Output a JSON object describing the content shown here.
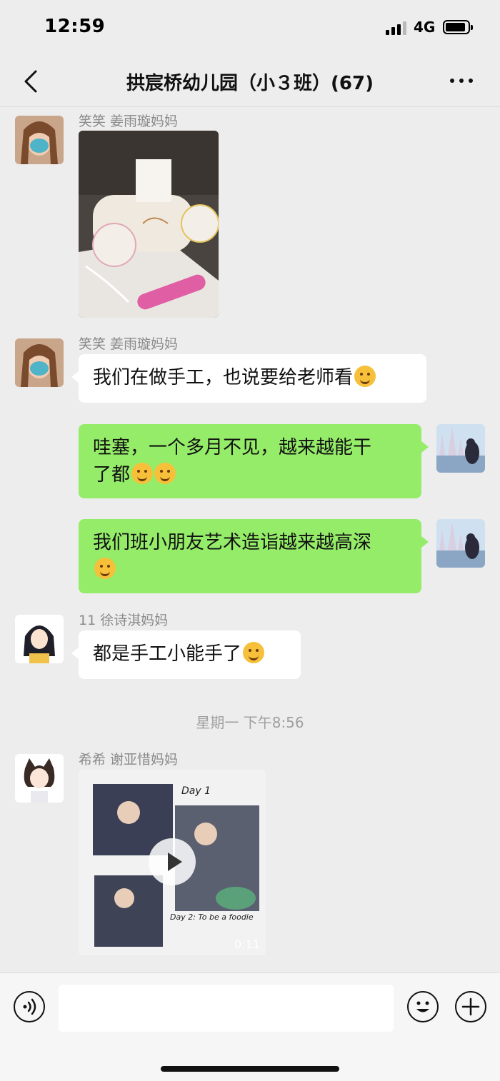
{
  "status_bar": {
    "time": "12:59",
    "network": "4G"
  },
  "nav": {
    "title": "拱宸桥幼儿园（小３班）(67)"
  },
  "messages": [
    {
      "sender": "笑笑  姜雨璇妈妈",
      "type": "image"
    },
    {
      "sender": "笑笑  姜雨璇妈妈",
      "text": "我们在做手工，也说要给老师看",
      "emoji": "hmm-face"
    },
    {
      "self": true,
      "line1": "哇塞，一个多月不见，越来越能干",
      "line2": "了都",
      "emoji": "blush-face"
    },
    {
      "self": true,
      "line1": "我们班小朋友艺术造诣越来越高深",
      "emoji": "hmm-face"
    },
    {
      "sender": "11  徐诗淇妈妈",
      "text": "都是手工小能手了",
      "emoji": "wink-face"
    },
    {
      "timestamp": "星期一 下午8:56"
    },
    {
      "sender": "希希   谢亚惜妈妈",
      "type": "video",
      "duration": "0:11",
      "captions": [
        "Day 1",
        "Day 2: To be a foodie"
      ]
    }
  ],
  "colors": {
    "self_bubble": "#95ec69",
    "other_bubble": "#ffffff",
    "background": "#ededed"
  }
}
